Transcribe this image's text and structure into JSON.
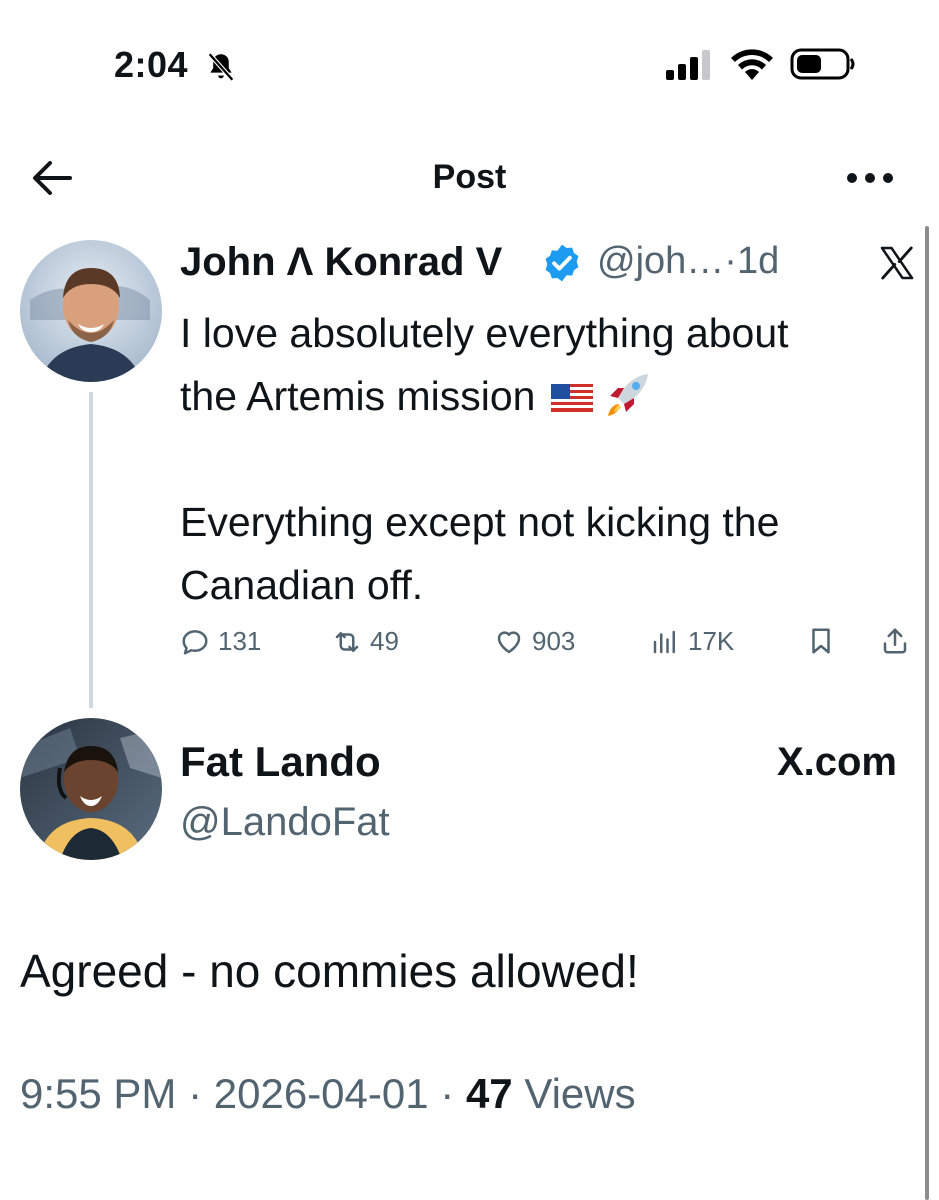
{
  "status_bar": {
    "time": "2:04",
    "bell_icon": "bell-slash-icon",
    "signal_icon": "cellular-signal-icon",
    "wifi_icon": "wifi-icon",
    "battery_icon": "battery-icon"
  },
  "nav": {
    "back_icon": "arrow-left-icon",
    "title": "Post",
    "more_icon": "ellipsis-icon"
  },
  "quoted_tweet": {
    "author_name": "John Λ Konrad V",
    "verified_color": "#1d9bf0",
    "handle": "@joh…",
    "separator": "·",
    "age": "1d",
    "line1": "I love absolutely everything about",
    "line2": "the Artemis mission",
    "line3": "Everything except not kicking the",
    "line4": "Canadian off.",
    "emojis": [
      "us-flag-emoji",
      "rocket-emoji"
    ],
    "actions": {
      "replies": "131",
      "reposts": "49",
      "likes": "903",
      "views": "17K"
    }
  },
  "reply": {
    "author_name": "Fat Lando",
    "handle": "@LandoFat",
    "source": "X.com",
    "text": "Agreed - no commies allowed!",
    "time": "9:55 PM",
    "date": "2026-04-01",
    "separator": "·",
    "views_count": "47",
    "views_label": "Views"
  },
  "colors": {
    "text": "#0f1419",
    "secondary": "#536471",
    "thread_line": "#cfd9de",
    "verified": "#1d9bf0"
  }
}
